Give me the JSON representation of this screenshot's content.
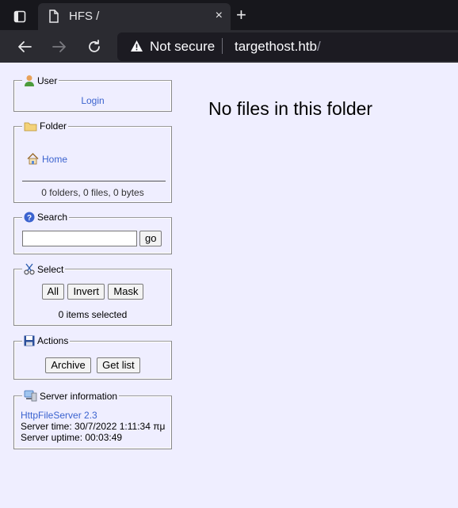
{
  "browser": {
    "tab_title": "HFS /",
    "tab_close": "×",
    "new_tab": "+",
    "security_label": "Not secure",
    "url_host": "targethost.htb",
    "url_path": "/"
  },
  "panels": {
    "user": {
      "title": "User",
      "login": "Login"
    },
    "folder": {
      "title": "Folder",
      "home": "Home",
      "stats": "0 folders, 0 files, 0 bytes"
    },
    "search": {
      "title": "Search",
      "query": "",
      "go": "go"
    },
    "select": {
      "title": "Select",
      "all": "All",
      "invert": "Invert",
      "mask": "Mask",
      "status": "0 items selected"
    },
    "actions": {
      "title": "Actions",
      "archive": "Archive",
      "get_list": "Get list"
    },
    "server": {
      "title": "Server information",
      "software": "HttpFileServer 2.3",
      "time": "Server time: 30/7/2022 1:11:34 πμ",
      "uptime": "Server uptime: 00:03:49"
    }
  },
  "main": {
    "message": "No files in this folder"
  },
  "colors": {
    "page_bg": "#efeeff",
    "link": "#3b63cf",
    "chrome_bg": "#2b2b31",
    "tabbar_bg": "#17171c"
  }
}
